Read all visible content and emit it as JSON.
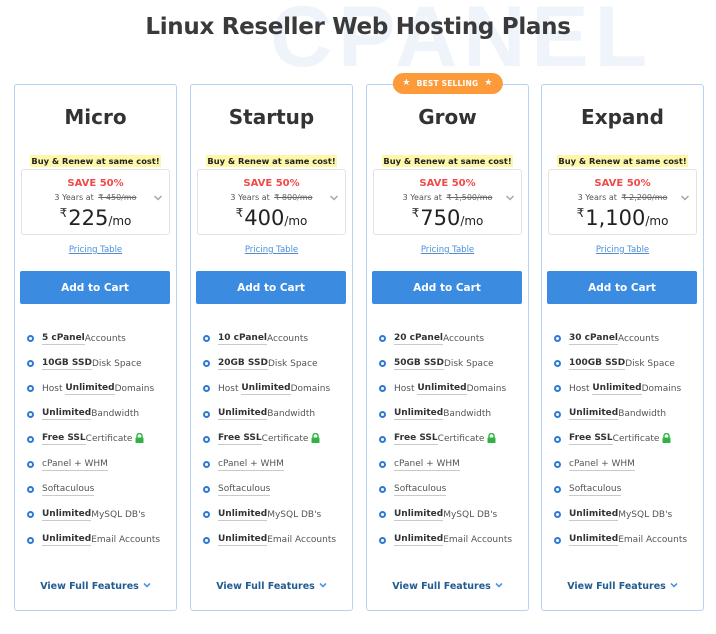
{
  "watermark": "CPANEL",
  "page_title": "Linux Reseller Web Hosting Plans",
  "colors": {
    "accent_blue": "#3b8be0",
    "save_red": "#f04a4a",
    "badge_orange": "#fd9a3a",
    "promo_highlight": "#fdf7a8",
    "card_border": "#b5d2f4",
    "lock_green": "#2fb344"
  },
  "plans": [
    {
      "name": "Micro",
      "badge": null,
      "promo": "Buy & Renew at same cost!",
      "save": "SAVE 50%",
      "term_prefix": "3 Years at",
      "old_price": "₹ 450/mo",
      "currency": "₹",
      "price": "225",
      "per": "/mo",
      "pricing_link": "Pricing Table",
      "cart_label": "Add to Cart",
      "features": {
        "accounts_bold": "5 cPanel",
        "accounts_rest": " Accounts",
        "disk_bold": "10GB SSD",
        "disk_rest": " Disk Space",
        "domains_pre": "Host ",
        "domains_bold": "Unlimited",
        "domains_rest": " Domains",
        "bw_bold": "Unlimited",
        "bw_rest": " Bandwidth",
        "ssl_bold": "Free SSL",
        "ssl_rest": " Certificate",
        "whm": "cPanel + WHM",
        "softaculous": "Softaculous",
        "mysql_bold": "Unlimited",
        "mysql_rest": " MySQL DB's",
        "email_bold": "Unlimited",
        "email_rest": " Email Accounts"
      },
      "view_full": "View Full Features"
    },
    {
      "name": "Startup",
      "badge": null,
      "promo": "Buy & Renew at same cost!",
      "save": "SAVE 50%",
      "term_prefix": "3 Years at",
      "old_price": "₹ 800/mo",
      "currency": "₹",
      "price": "400",
      "per": "/mo",
      "pricing_link": "Pricing Table",
      "cart_label": "Add to Cart",
      "features": {
        "accounts_bold": "10 cPanel",
        "accounts_rest": " Accounts",
        "disk_bold": "20GB SSD",
        "disk_rest": " Disk Space",
        "domains_pre": "Host ",
        "domains_bold": "Unlimited",
        "domains_rest": " Domains",
        "bw_bold": "Unlimited",
        "bw_rest": " Bandwidth",
        "ssl_bold": "Free SSL",
        "ssl_rest": " Certificate",
        "whm": "cPanel + WHM",
        "softaculous": "Softaculous",
        "mysql_bold": "Unlimited",
        "mysql_rest": " MySQL DB's",
        "email_bold": "Unlimited",
        "email_rest": " Email Accounts"
      },
      "view_full": "View Full Features"
    },
    {
      "name": "Grow",
      "badge": "BEST SELLING",
      "promo": "Buy & Renew at same cost!",
      "save": "SAVE 50%",
      "term_prefix": "3 Years at",
      "old_price": "₹ 1,500/mo",
      "currency": "₹",
      "price": "750",
      "per": "/mo",
      "pricing_link": "Pricing Table",
      "cart_label": "Add to Cart",
      "features": {
        "accounts_bold": "20 cPanel",
        "accounts_rest": " Accounts",
        "disk_bold": "50GB SSD",
        "disk_rest": " Disk Space",
        "domains_pre": "Host ",
        "domains_bold": "Unlimited",
        "domains_rest": " Domains",
        "bw_bold": "Unlimited",
        "bw_rest": " Bandwidth",
        "ssl_bold": "Free SSL",
        "ssl_rest": " Certificate",
        "whm": "cPanel + WHM",
        "softaculous": "Softaculous",
        "mysql_bold": "Unlimited",
        "mysql_rest": " MySQL DB's",
        "email_bold": "Unlimited",
        "email_rest": " Email Accounts"
      },
      "view_full": "View Full Features"
    },
    {
      "name": "Expand",
      "badge": null,
      "promo": "Buy & Renew at same cost!",
      "save": "SAVE 50%",
      "term_prefix": "3 Years at",
      "old_price": "₹ 2,200/mo",
      "currency": "₹",
      "price": "1,100",
      "per": "/mo",
      "pricing_link": "Pricing Table",
      "cart_label": "Add to Cart",
      "features": {
        "accounts_bold": "30 cPanel",
        "accounts_rest": " Accounts",
        "disk_bold": "100GB SSD",
        "disk_rest": " Disk Space",
        "domains_pre": "Host ",
        "domains_bold": "Unlimited",
        "domains_rest": " Domains",
        "bw_bold": "Unlimited",
        "bw_rest": " Bandwidth",
        "ssl_bold": "Free SSL",
        "ssl_rest": " Certificate",
        "whm": "cPanel + WHM",
        "softaculous": "Softaculous",
        "mysql_bold": "Unlimited",
        "mysql_rest": " MySQL DB's",
        "email_bold": "Unlimited",
        "email_rest": " Email Accounts"
      },
      "view_full": "View Full Features"
    }
  ]
}
